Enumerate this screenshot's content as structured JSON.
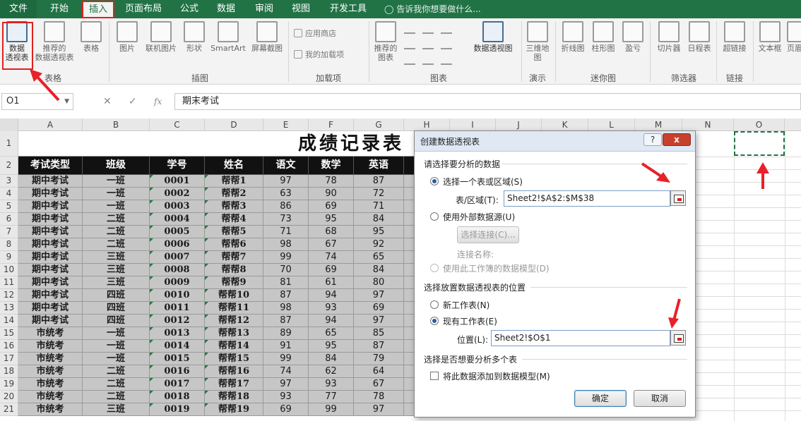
{
  "tabs": [
    "文件",
    "开始",
    "插入",
    "页面布局",
    "公式",
    "数据",
    "审阅",
    "视图",
    "开发工具"
  ],
  "tell_me": "告诉我你想要做什么...",
  "ribbon": {
    "pivot_table": [
      "数据",
      "透视表"
    ],
    "recommended_pivot": [
      "推荐的",
      "数据透视表"
    ],
    "table": "表格",
    "picture": "图片",
    "online_picture": "联机图片",
    "shapes": "形状",
    "smartart": "SmartArt",
    "screenshot": "屏幕截图",
    "app_store": "应用商店",
    "my_addins": "我的加载项",
    "recommended_charts": [
      "推荐的",
      "图表"
    ],
    "pivot_chart": "数据透视图",
    "map3d": [
      "三维地",
      "图"
    ],
    "line_spark": "折线图",
    "column_spark": "柱形图",
    "winloss_spark": "盈亏",
    "slicer": "切片器",
    "timeline": "日程表",
    "hyperlink": "超链接",
    "textbox": "文本框",
    "header": "页眉",
    "groups": [
      "表格",
      "插图",
      "加载项",
      "图表",
      "演示",
      "迷你图",
      "筛选器",
      "链接"
    ]
  },
  "formula_bar": {
    "name_box": "O1",
    "fx": "fx",
    "content": "期末考试"
  },
  "columns": [
    "A",
    "B",
    "C",
    "D",
    "E",
    "F",
    "G",
    "H",
    "I",
    "J",
    "K",
    "L",
    "M",
    "N",
    "O"
  ],
  "sheet": {
    "title": "成绩记录表",
    "headers": [
      "考试类型",
      "班级",
      "学号",
      "姓名",
      "语文",
      "数学",
      "英语"
    ],
    "rows": [
      [
        "期中考试",
        "一班",
        "0001",
        "帮帮1",
        "97",
        "78",
        "87"
      ],
      [
        "期中考试",
        "一班",
        "0002",
        "帮帮2",
        "63",
        "90",
        "72"
      ],
      [
        "期中考试",
        "一班",
        "0003",
        "帮帮3",
        "86",
        "69",
        "71"
      ],
      [
        "期中考试",
        "二班",
        "0004",
        "帮帮4",
        "73",
        "95",
        "84"
      ],
      [
        "期中考试",
        "二班",
        "0005",
        "帮帮5",
        "71",
        "68",
        "95"
      ],
      [
        "期中考试",
        "二班",
        "0006",
        "帮帮6",
        "98",
        "67",
        "92"
      ],
      [
        "期中考试",
        "三班",
        "0007",
        "帮帮7",
        "99",
        "74",
        "65"
      ],
      [
        "期中考试",
        "三班",
        "0008",
        "帮帮8",
        "70",
        "69",
        "84"
      ],
      [
        "期中考试",
        "三班",
        "0009",
        "帮帮9",
        "81",
        "61",
        "80"
      ],
      [
        "期中考试",
        "四班",
        "0010",
        "帮帮10",
        "87",
        "94",
        "97"
      ],
      [
        "期中考试",
        "四班",
        "0011",
        "帮帮11",
        "98",
        "93",
        "69"
      ],
      [
        "期中考试",
        "四班",
        "0012",
        "帮帮12",
        "87",
        "94",
        "97"
      ],
      [
        "市统考",
        "一班",
        "0013",
        "帮帮13",
        "89",
        "65",
        "85"
      ],
      [
        "市统考",
        "一班",
        "0014",
        "帮帮14",
        "91",
        "95",
        "87"
      ],
      [
        "市统考",
        "一班",
        "0015",
        "帮帮15",
        "99",
        "84",
        "79"
      ],
      [
        "市统考",
        "二班",
        "0016",
        "帮帮16",
        "74",
        "62",
        "64"
      ],
      [
        "市统考",
        "二班",
        "0017",
        "帮帮17",
        "97",
        "93",
        "67"
      ],
      [
        "市统考",
        "二班",
        "0018",
        "帮帮18",
        "93",
        "77",
        "78"
      ],
      [
        "市统考",
        "三班",
        "0019",
        "帮帮19",
        "69",
        "99",
        "97"
      ]
    ]
  },
  "dialog": {
    "title": "创建数据透视表",
    "help": "?",
    "close": "x",
    "section1": "请选择要分析的数据",
    "opt_select_range": "选择一个表或区域(S)",
    "table_range_label": "表/区域(T):",
    "table_range_value": "Sheet2!$A$2:$M$38",
    "opt_external": "使用外部数据源(U)",
    "choose_connection": "选择连接(C)...",
    "connection_name": "连接名称:",
    "opt_data_model": "使用此工作簿的数据模型(D)",
    "section2": "选择放置数据透视表的位置",
    "opt_new_sheet": "新工作表(N)",
    "opt_existing_sheet": "现有工作表(E)",
    "location_label": "位置(L):",
    "location_value": "Sheet2!$O$1",
    "section3": "选择是否想要分析多个表",
    "add_to_model": "将此数据添加到数据模型(M)",
    "ok": "确定",
    "cancel": "取消"
  },
  "colors": {
    "accent": "#217346",
    "highlight": "#e02020"
  }
}
